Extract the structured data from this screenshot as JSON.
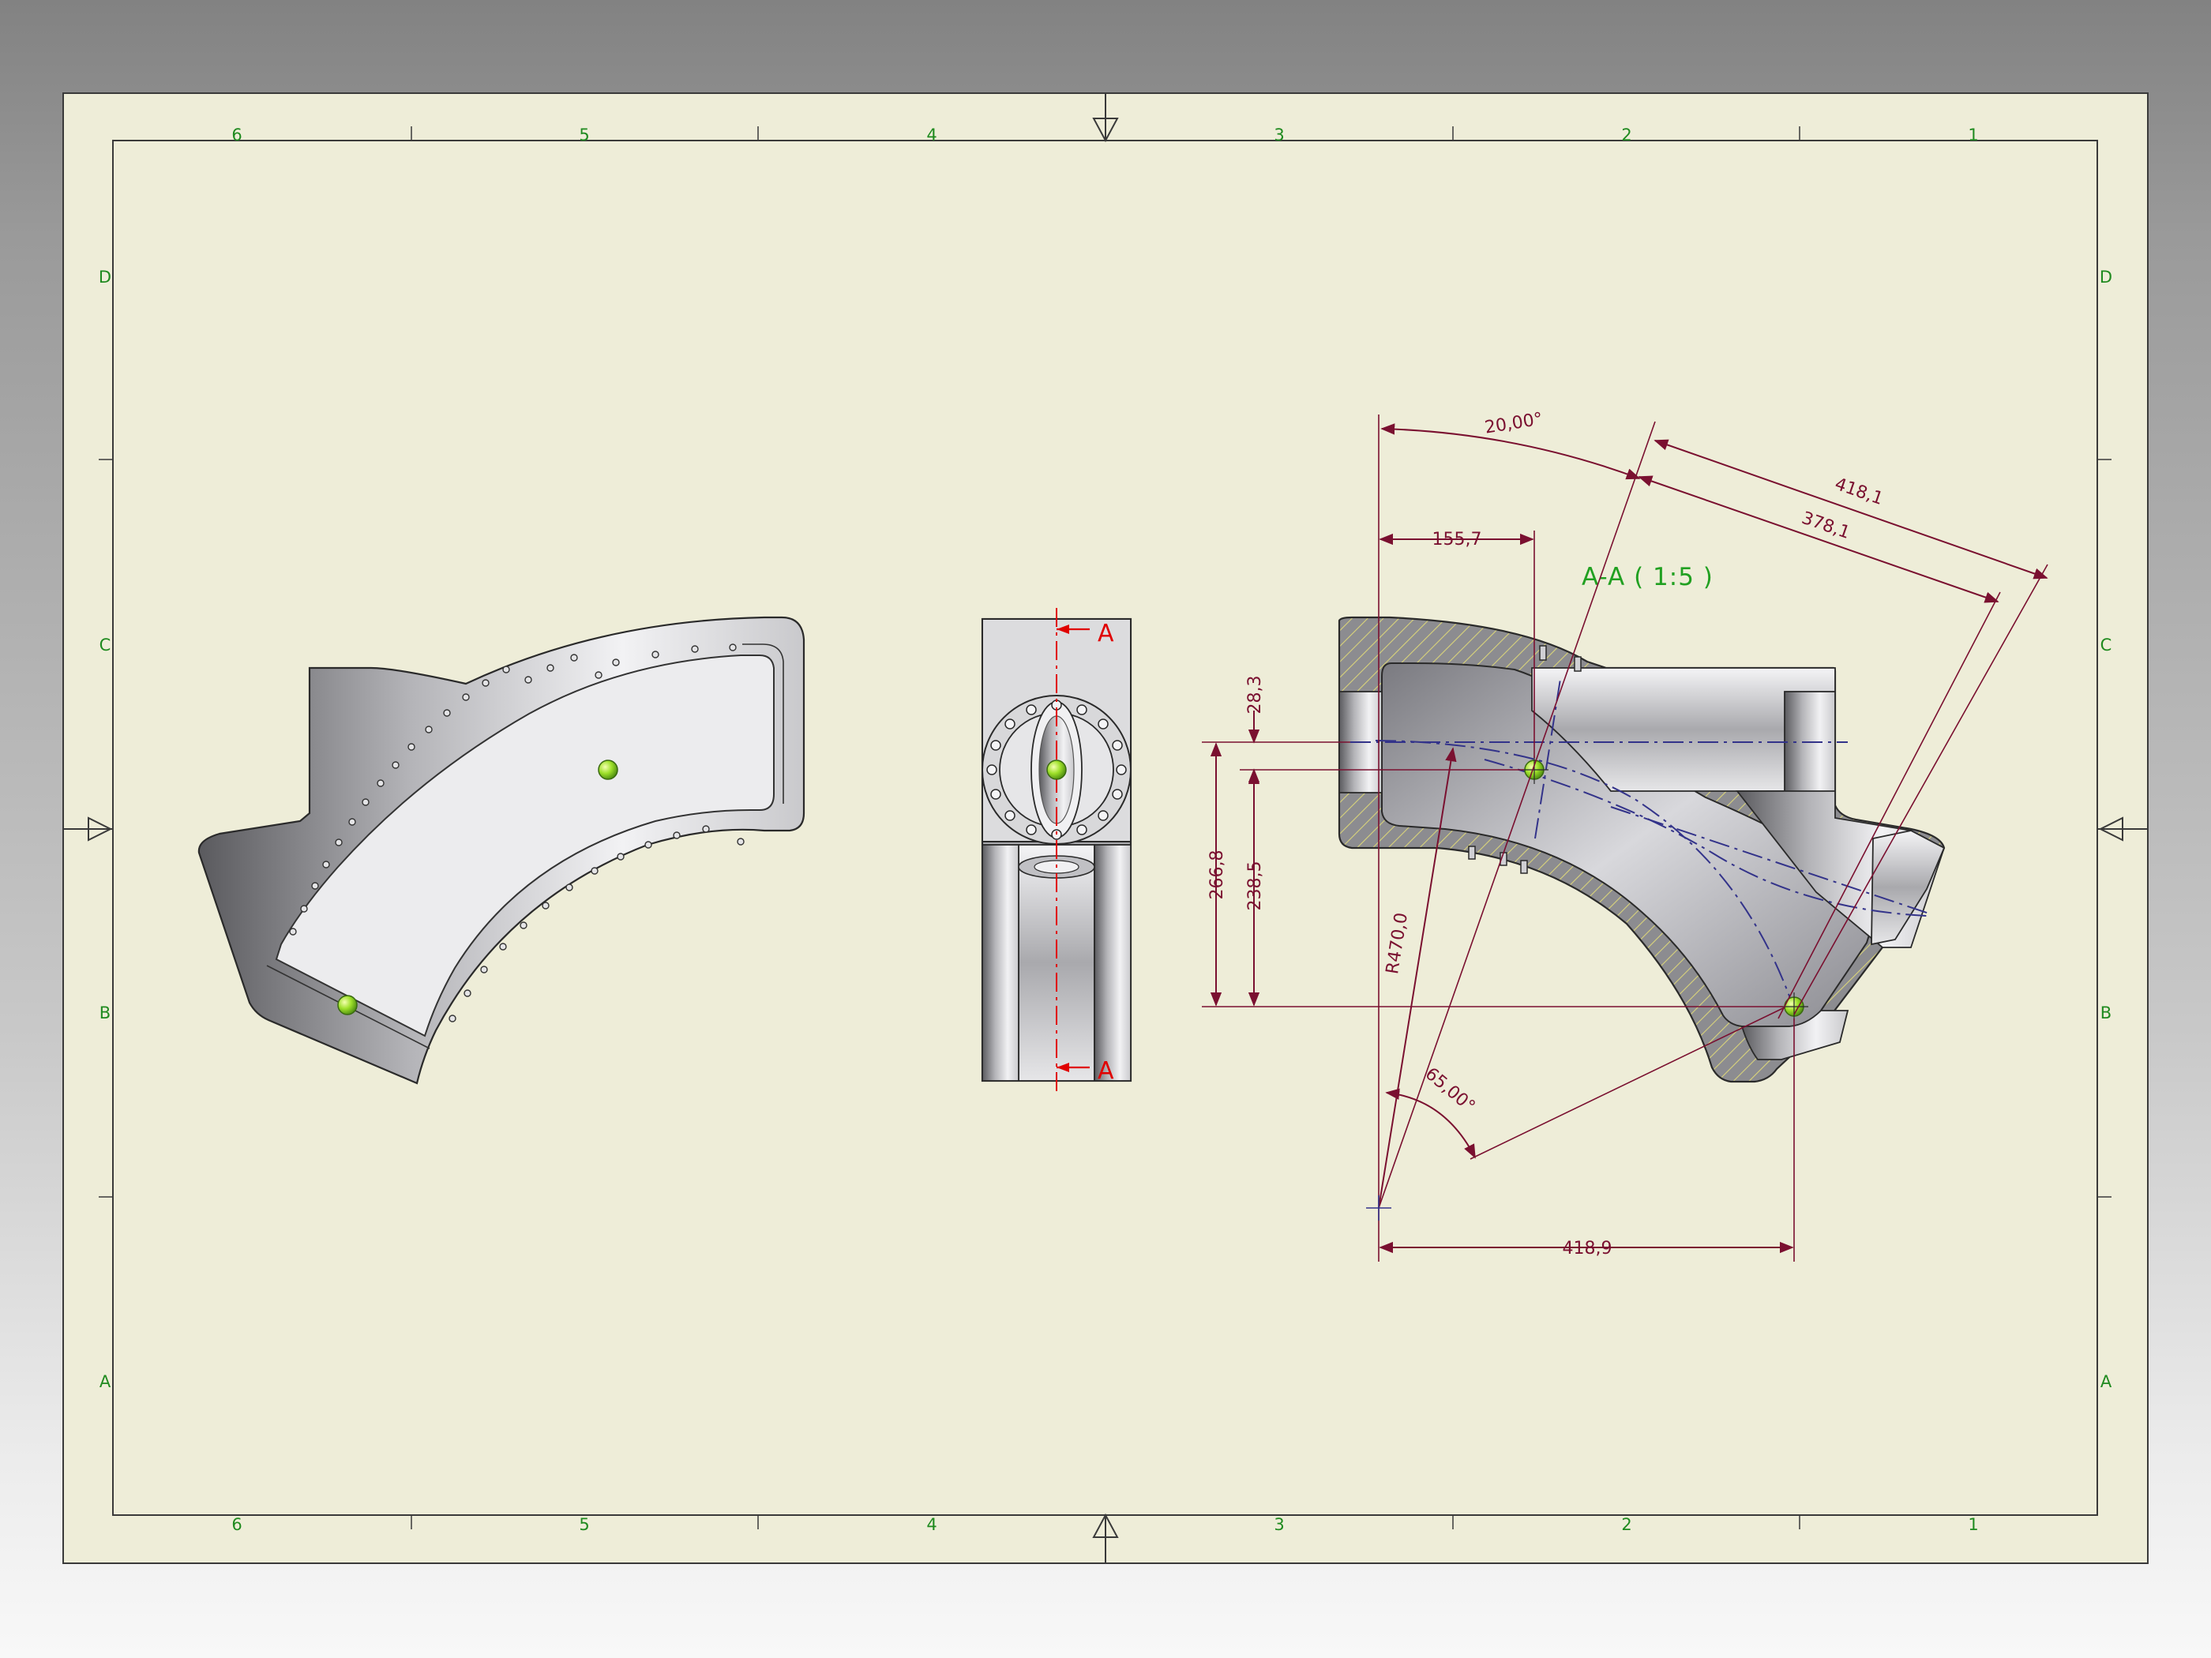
{
  "sheet": {
    "zone_columns": [
      "6",
      "5",
      "4",
      "3",
      "2",
      "1"
    ],
    "zone_rows": [
      "D",
      "C",
      "B",
      "A"
    ]
  },
  "section_view": {
    "title": "A-A  ( 1:5 )",
    "cut_label": "A"
  },
  "dimensions": {
    "angle_top": "20,00°",
    "length_418_1": "418,1",
    "length_378_1": "378,1",
    "horiz_155_7": "155,7",
    "vert_28_3": "28,3",
    "vert_266_8": "266,8",
    "vert_238_5": "238,5",
    "radius": "R470,0",
    "angle_bottom": "65,00°",
    "horiz_418_9": "418,9"
  },
  "colors": {
    "sheet_fill": "#eeedd8",
    "border_line": "#3a3a3a",
    "zone_text": "#1f8a1f",
    "dimension": "#7a1030",
    "section_title": "#21a021",
    "cut_line": "#e00000",
    "centerline": "#33338a",
    "hatch": "#d9d37a",
    "marker": "#9ee02a"
  }
}
